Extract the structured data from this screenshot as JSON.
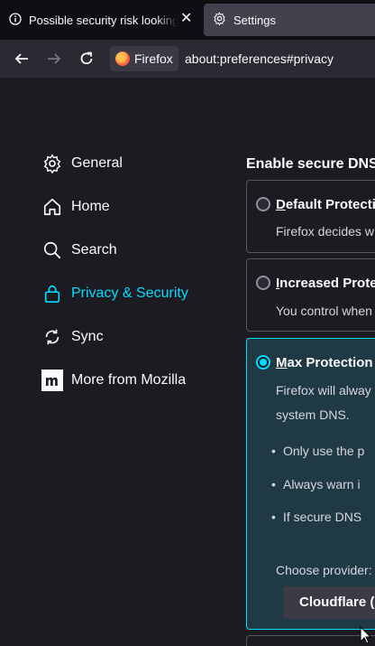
{
  "tabs": [
    {
      "label": "Possible security risk looking up",
      "icon": "info-icon",
      "active": false
    },
    {
      "label": "Settings",
      "icon": "gear-icon",
      "active": true
    }
  ],
  "toolbar": {
    "identity_label": "Firefox",
    "url": "about:preferences#privacy"
  },
  "sidebar": {
    "items": [
      {
        "label": "General",
        "icon": "gear-icon"
      },
      {
        "label": "Home",
        "icon": "home-icon"
      },
      {
        "label": "Search",
        "icon": "search-icon"
      },
      {
        "label": "Privacy & Security",
        "icon": "lock-icon",
        "selected": true
      },
      {
        "label": "Sync",
        "icon": "sync-icon"
      },
      {
        "label": "More from Mozilla",
        "icon": "mozilla-icon"
      }
    ]
  },
  "dns": {
    "title": "Enable secure DNS",
    "options": [
      {
        "label": "Default Protection",
        "desc": "Firefox decides w",
        "selected": false
      },
      {
        "label": "Increased Protect",
        "desc": "You control when",
        "selected": false
      },
      {
        "label": "Max Protection",
        "desc_line1": "Firefox will alway",
        "desc_line2": "system DNS.",
        "selected": true,
        "bullets": [
          "Only use the p",
          "Always warn i",
          "If secure DNS"
        ],
        "choose_provider": "Choose provider:",
        "provider": "Cloudflare (D"
      }
    ]
  },
  "colors": {
    "accent": "#00ddff",
    "background": "#1c1b22",
    "tabbar": "#0f0e13",
    "navbar": "#2b2a33"
  }
}
